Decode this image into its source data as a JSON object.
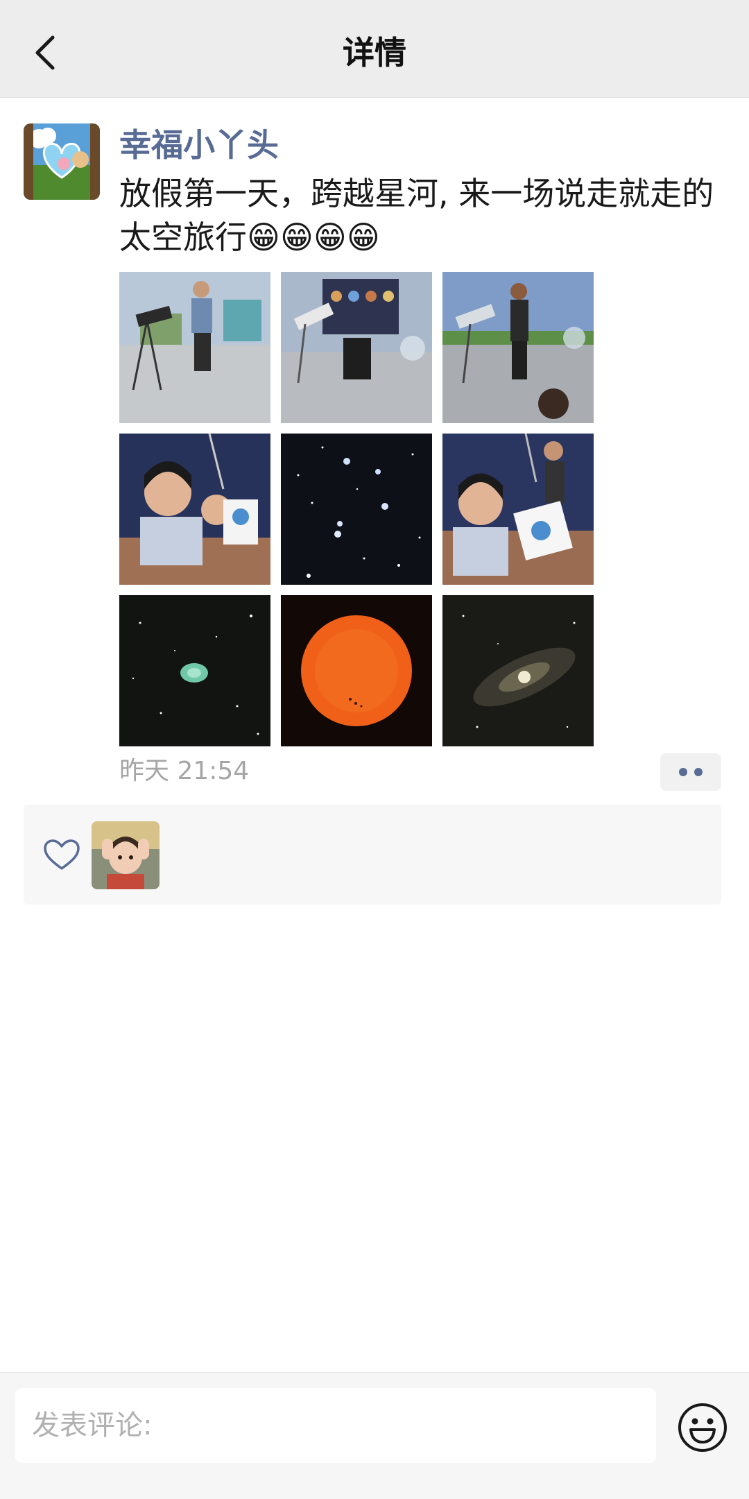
{
  "header": {
    "title": "详情",
    "back_icon": "chevron-left-icon"
  },
  "post": {
    "username": "幸福小丫头",
    "text": "放假第一天，跨越星河, 来一场说走就走的太空旅行😁😁😁😁",
    "timestamp": "昨天 21:54",
    "photos": [
      "telescope-on-plaza",
      "planet-poster-stargazing",
      "man-with-telescope",
      "girl-holding-book",
      "pleiades-star-cluster",
      "girl-with-planisphere",
      "green-nebula",
      "orange-sun",
      "andromeda-galaxy"
    ],
    "more_icon": "more-dots-icon"
  },
  "likes": {
    "icon": "heart-icon"
  },
  "comment": {
    "placeholder": "发表评论:",
    "value": "",
    "emoji_icon": "emoji-icon"
  },
  "colors": {
    "link": "#576b95",
    "header_bg": "#ededed",
    "likes_bg": "#f7f7f7",
    "timestamp": "#a5a5a5"
  }
}
